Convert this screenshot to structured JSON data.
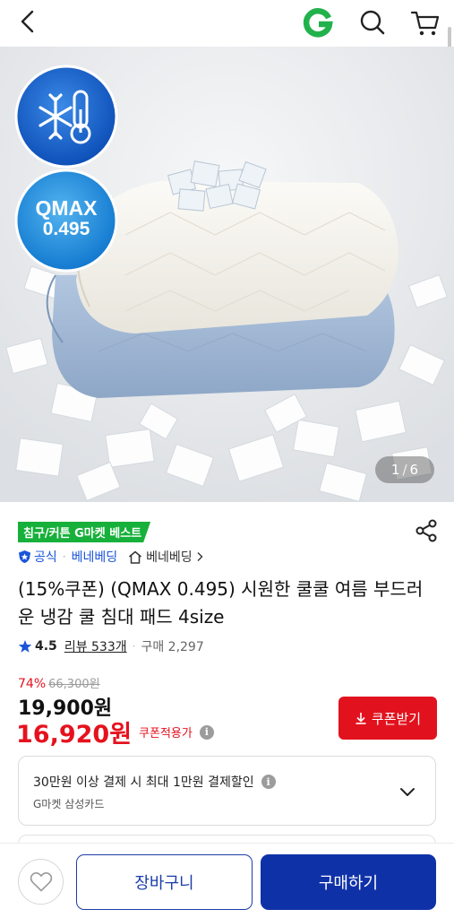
{
  "header": {
    "back_icon": "chevron-left-icon",
    "logo_icon": "gmarket-g-logo",
    "search_icon": "search-icon",
    "cart_icon": "cart-icon",
    "logo_color": "#22b24c"
  },
  "gallery": {
    "current": "1",
    "divider": "/",
    "total": "6",
    "badges": [
      {
        "icon": "snowflake-thermometer-icon"
      },
      {
        "line1": "QMAX",
        "line2": "0.495"
      }
    ]
  },
  "product": {
    "best_badge": "침구/커튼 G마켓 베스트",
    "official_label": "공식",
    "brand": "베네베딩",
    "store_name": "베네베딩",
    "title": "(15%쿠폰) (QMAX 0.495) 시원한 쿨쿨 여름 부드러운 냉감 쿨 침대 패드 4size",
    "rating": "4.5",
    "review_label": "리뷰 533개",
    "purchase_label": "구매 2,297",
    "discount_rate": "74%",
    "original_price": "66,300원",
    "price": "19,900원",
    "coupon_price": "16,920원",
    "coupon_applied_label": "쿠폰적용가",
    "info_glyph": "i"
  },
  "coupon_button": {
    "label": "쿠폰받기",
    "icon": "download-arrow-icon"
  },
  "card_benefit": {
    "main": "30만원 이상 결제 시 최대 1만원 결제할인",
    "sub": "G마켓 삼성카드"
  },
  "bottom": {
    "wishlist_icon": "heart-icon",
    "cart_label": "장바구니",
    "buy_label": "구매하기"
  },
  "colors": {
    "accent_red": "#e1121e",
    "primary_blue": "#0f31a8",
    "badge_green": "#16b03a"
  }
}
